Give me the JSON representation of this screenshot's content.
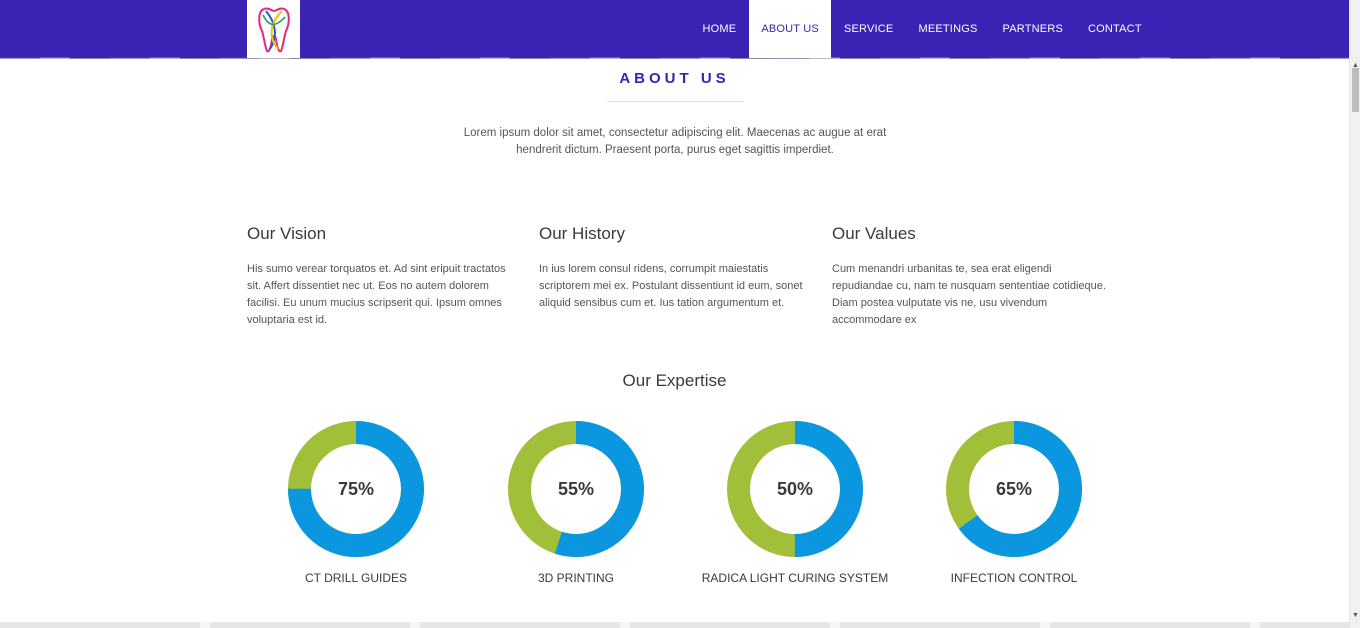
{
  "nav": {
    "items": [
      {
        "label": "HOME",
        "active": false
      },
      {
        "label": "ABOUT US",
        "active": true
      },
      {
        "label": "SERVICE",
        "active": false
      },
      {
        "label": "MEETINGS",
        "active": false
      },
      {
        "label": "PARTNERS",
        "active": false
      },
      {
        "label": "CONTACT",
        "active": false
      }
    ]
  },
  "about": {
    "title": "ABOUT US",
    "intro": "Lorem ipsum dolor sit amet, consectetur adipiscing elit. Maecenas ac augue at erat hendrerit dictum. Praesent porta, purus eget sagittis imperdiet."
  },
  "columns": [
    {
      "heading": "Our Vision",
      "text": "His sumo verear torquatos et. Ad sint eripuit tractatos sit. Affert dissentiet nec ut. Eos no autem dolorem facilisi. Eu unum mucius scripserit qui. Ipsum omnes voluptaria est id."
    },
    {
      "heading": "Our History",
      "text": "In ius lorem consul ridens, corrumpit maiestatis scriptorem mei ex. Postulant dissentiunt id eum, sonet aliquid sensibus cum et. Ius tation argumentum et."
    },
    {
      "heading": "Our Values",
      "text": "Cum menandri urbanitas te, sea erat eligendi repudiandae cu, nam te nusquam sententiae cotidieque. Diam postea vulputate vis ne, usu vivendum accommodare ex"
    }
  ],
  "expertise": {
    "title": "Our Expertise",
    "colors": {
      "primary": "#0b97df",
      "secondary": "#a2bf3a"
    }
  },
  "chart_data": {
    "type": "pie",
    "charts": [
      {
        "label": "CT DRILL GUIDES",
        "value": 75,
        "value_text": "75%"
      },
      {
        "label": "3D PRINTING",
        "value": 55,
        "value_text": "55%"
      },
      {
        "label": "RADICA LIGHT CURING SYSTEM",
        "value": 50,
        "value_text": "50%"
      },
      {
        "label": "INFECTION CONTROL",
        "value": 65,
        "value_text": "65%"
      }
    ]
  },
  "theme": {
    "brand": "#3a22b4"
  }
}
